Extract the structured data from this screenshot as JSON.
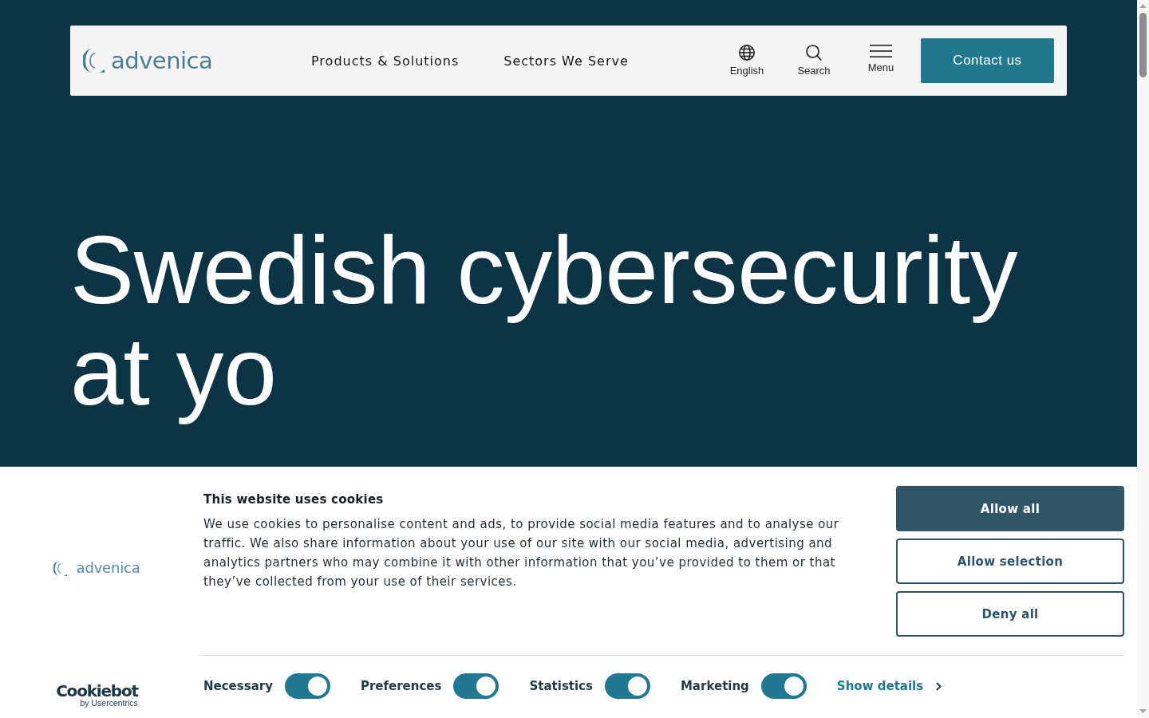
{
  "header": {
    "logo": "advenica",
    "nav": [
      {
        "label": "Products & Solutions"
      },
      {
        "label": "Sectors We Serve"
      }
    ],
    "tools": [
      {
        "kind": "language",
        "label": "English"
      },
      {
        "kind": "search",
        "label": "Search"
      },
      {
        "kind": "menu",
        "label": "Menu"
      }
    ],
    "contact_button": "Contact us"
  },
  "hero": {
    "heading": "Swedish cybersecurity at yo"
  },
  "cookie_banner": {
    "logo": "advenica",
    "title": "This website uses cookies",
    "body": "We use cookies to personalise content and ads, to provide social media features and to analyse our traffic. We also share information about your use of our site with our social media, advertising and analytics partners who may combine it with other information that you’ve provided to them or that they’ve collected from your use of their services.",
    "buttons": [
      {
        "kind": "primary",
        "label": "Allow all"
      },
      {
        "kind": "outline",
        "label": "Allow selection"
      },
      {
        "kind": "outline",
        "label": "Deny all"
      }
    ],
    "consents": [
      {
        "label": "Necessary",
        "on": true
      },
      {
        "label": "Preferences",
        "on": true
      },
      {
        "label": "Statistics",
        "on": true
      },
      {
        "label": "Marketing",
        "on": true
      }
    ],
    "show_details": "Show details",
    "provider": {
      "name": "Cookiebot",
      "byline": "by Usercentrics"
    }
  }
}
